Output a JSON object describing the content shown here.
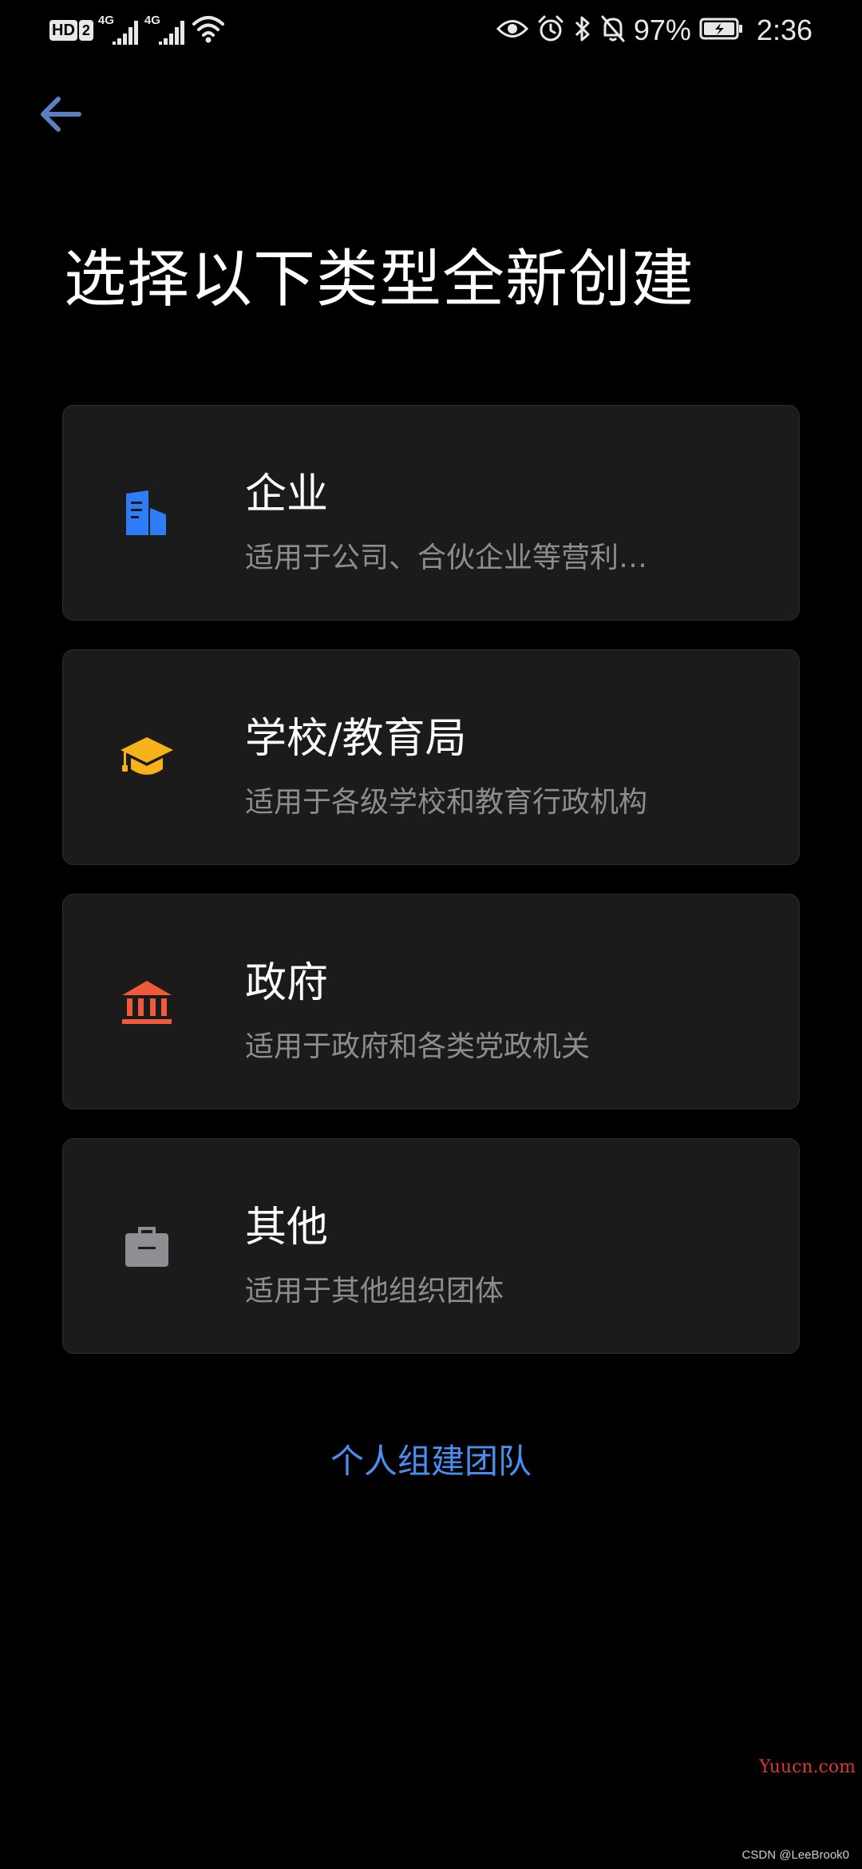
{
  "status_bar": {
    "hd_label": "HD",
    "sim_label": "2",
    "signal_1_tech": "4G",
    "signal_2_tech": "4G",
    "battery_percent": "97%",
    "time": "2:36"
  },
  "header": {
    "title": "选择以下类型全新创建"
  },
  "options": [
    {
      "title": "企业",
      "description": "适用于公司、合伙企业等营利…",
      "icon": "building-icon",
      "color": "#2f7df6"
    },
    {
      "title": "学校/教育局",
      "description": "适用于各级学校和教育行政机构",
      "icon": "graduation-cap-icon",
      "color": "#f6b21a"
    },
    {
      "title": "政府",
      "description": "适用于政府和各类党政机关",
      "icon": "government-building-icon",
      "color": "#f05a3a"
    },
    {
      "title": "其他",
      "description": "适用于其他组织团体",
      "icon": "briefcase-icon",
      "color": "#8e8e93"
    }
  ],
  "footer": {
    "personal_team_link": "个人组建团队"
  },
  "watermarks": {
    "site": "Yuucn.com",
    "csdn": "CSDN @LeeBrook0"
  },
  "colors": {
    "background": "#000000",
    "card": "#1b1b1c",
    "accent_link": "#4a8ff0",
    "back_arrow": "#5b7fc0"
  }
}
